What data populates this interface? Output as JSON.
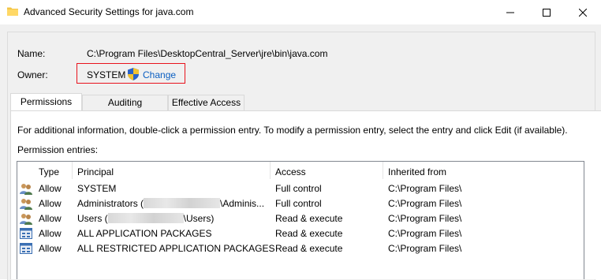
{
  "window": {
    "title": "Advanced Security Settings for java.com",
    "controls": [
      "minimize",
      "maximize",
      "close"
    ]
  },
  "name": {
    "label": "Name:",
    "value": "C:\\Program Files\\DesktopCentral_Server\\jre\\bin\\java.com"
  },
  "owner": {
    "label": "Owner:",
    "value": "SYSTEM",
    "change_label": "Change"
  },
  "tabs": [
    {
      "label": "Permissions",
      "active": true
    },
    {
      "label": "Auditing",
      "active": false
    },
    {
      "label": "Effective Access",
      "active": false
    }
  ],
  "permissions": {
    "info": "For additional information, double-click a permission entry. To modify a permission entry, select the entry and click Edit (if available).",
    "entries_label": "Permission entries:",
    "columns": [
      "Type",
      "Principal",
      "Access",
      "Inherited from"
    ],
    "rows": [
      {
        "icon": "users-icon",
        "type": "Allow",
        "principal_a": "SYSTEM",
        "principal_b": "",
        "access": "Full control",
        "inherited": "C:\\Program Files\\"
      },
      {
        "icon": "users-icon",
        "type": "Allow",
        "principal_a": "Administrators (",
        "principal_b": "\\Adminis...",
        "access": "Full control",
        "inherited": "C:\\Program Files\\"
      },
      {
        "icon": "users-icon",
        "type": "Allow",
        "principal_a": "Users (",
        "principal_b": "\\Users)",
        "access": "Read & execute",
        "inherited": "C:\\Program Files\\"
      },
      {
        "icon": "app-packages-icon",
        "type": "Allow",
        "principal_a": "ALL APPLICATION PACKAGES",
        "principal_b": "",
        "access": "Read & execute",
        "inherited": "C:\\Program Files\\"
      },
      {
        "icon": "app-packages-icon",
        "type": "Allow",
        "principal_a": "ALL RESTRICTED APPLICATION PACKAGES",
        "principal_b": "",
        "access": "Read & execute",
        "inherited": "C:\\Program Files\\"
      }
    ]
  },
  "colors": {
    "highlight_border": "#e8121c",
    "link": "#0b5fc2",
    "dialog_bg": "#f0f0f0"
  }
}
